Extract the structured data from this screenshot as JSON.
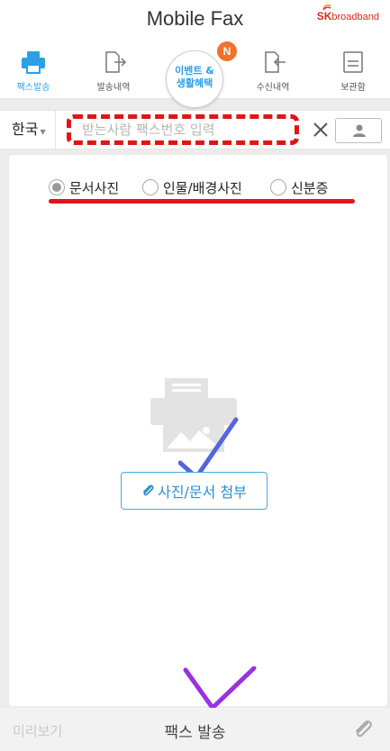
{
  "header": {
    "title": "Mobile Fax",
    "brand": {
      "sk": "SK",
      "name": "broadband"
    }
  },
  "nav": {
    "items": [
      {
        "label": "팩스발송",
        "icon": "printer-icon",
        "active": true
      },
      {
        "label": "발송내역",
        "icon": "outbox-icon",
        "active": false
      },
      {
        "label": "수신내역",
        "icon": "inbox-icon",
        "active": false
      },
      {
        "label": "보관함",
        "icon": "archive-icon",
        "active": false
      }
    ],
    "event": {
      "line1": "이벤트 &",
      "line2": "생활혜택",
      "badge": "N"
    }
  },
  "recipient": {
    "country": "한국",
    "fax_placeholder": "받는사람 팩스번호 입력",
    "fax_value": ""
  },
  "doc_types": {
    "options": [
      "문서사진",
      "인물/배경사진",
      "신분증"
    ],
    "selected": "문서사진"
  },
  "attach": {
    "label": "사진/문서 첨부"
  },
  "bottom": {
    "preview": "미리보기",
    "send": "팩스 발송"
  },
  "colors": {
    "accent": "#2aa0e6",
    "badge": "#f0732b",
    "annotation_red": "#e01515",
    "annotation_blue": "#5566dd",
    "annotation_purple": "#9b30e0"
  }
}
